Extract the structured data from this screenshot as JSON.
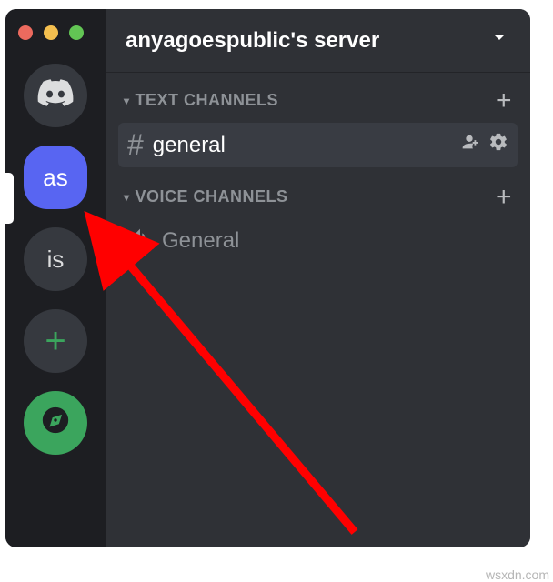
{
  "window": {
    "server_title": "anyagoespublic's server"
  },
  "servers": {
    "home_name": "home",
    "selected_label": "as",
    "other1_label": "is",
    "add_label": "+"
  },
  "categories": {
    "text": {
      "label": "TEXT CHANNELS"
    },
    "voice": {
      "label": "VOICE CHANNELS"
    }
  },
  "channels": {
    "text_general": "general",
    "voice_general": "General"
  },
  "watermark": "wsxdn.com"
}
